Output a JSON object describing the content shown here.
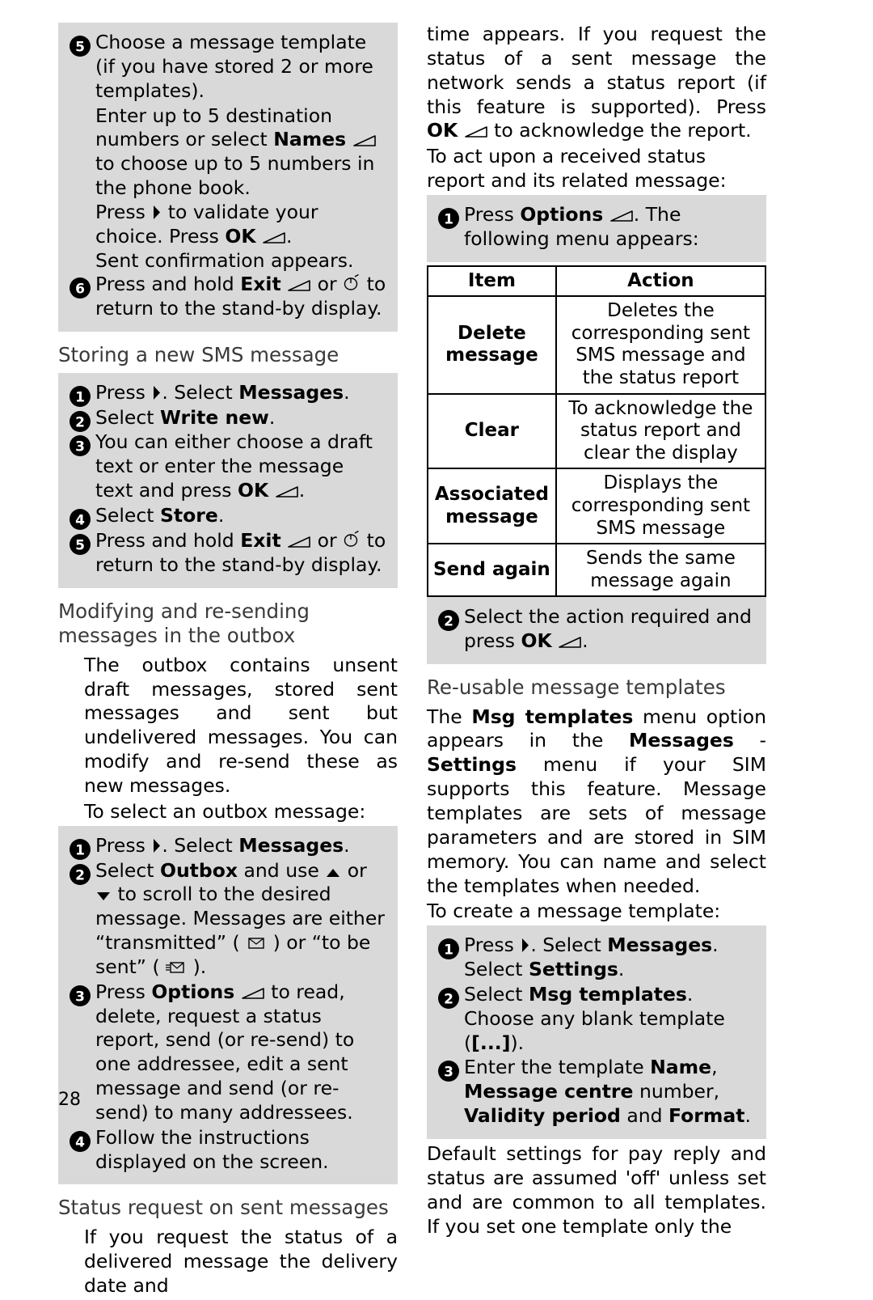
{
  "page_number": "28",
  "left_column": {
    "box1": {
      "steps": [
        {
          "num": 5,
          "lines": [
            "Choose a message template (if you have stored 2 or more templates).",
            "Enter up to 5 destination numbers or select __B:Names__ __ICON:softkey-left__ to choose up to 5 numbers in the phone book.",
            "Press __ICON:right-arrow__ to validate your choice. Press __B:OK__ __ICON:softkey-left__.",
            "Sent confirmation appears."
          ]
        },
        {
          "num": 6,
          "lines": [
            "Press and hold __B:Exit__ __ICON:softkey-right__ or __ICON:power-key__ to return to the stand-by display."
          ]
        }
      ]
    },
    "heading_storing": "Storing a new SMS message",
    "box2": {
      "steps": [
        {
          "num": 1,
          "lines": [
            "Press __ICON:right-arrow__. Select __B:Messages__."
          ]
        },
        {
          "num": 2,
          "lines": [
            "Select __B:Write new__."
          ]
        },
        {
          "num": 3,
          "lines": [
            "You can either choose a draft text or enter the message text and press __B:OK__ __ICON:softkey-left__."
          ]
        },
        {
          "num": 4,
          "lines": [
            "Select __B:Store__."
          ]
        },
        {
          "num": 5,
          "lines": [
            "Press and hold __B:Exit__ __ICON:softkey-right__ or __ICON:power-key__ to return to the stand-by display."
          ]
        }
      ]
    },
    "heading_modifying": "Modifying and re-sending messages in the outbox",
    "para_outbox": "The outbox contains unsent draft messages, stored sent messages and sent but undelivered messages. You can modify and re-send these as new messages.",
    "para_select_outbox": "To select an outbox message:",
    "box3": {
      "steps": [
        {
          "num": 1,
          "lines": [
            "Press __ICON:right-arrow__. Select __B:Messages__."
          ]
        },
        {
          "num": 2,
          "lines": [
            "Select __B:Outbox__ and use __ICON:up-arrow__ or __ICON:down-arrow__ to scroll to the desired message. Messages are either “transmitted” ( __ICON:envelope-sent__ ) or “to be sent” ( __ICON:envelope-pending__ )."
          ]
        },
        {
          "num": 3,
          "lines": [
            "Press __B:Options__ __ICON:softkey-left__ to read, delete, request a status report, send (or re-send) to one addressee, edit a sent message and send (or re-send) to many addressees."
          ]
        },
        {
          "num": 4,
          "lines": [
            "Follow the instructions displayed on the screen."
          ]
        }
      ]
    },
    "heading_status": "Status request on sent messages",
    "para_status": "If you request the status of a delivered message the delivery date and"
  },
  "right_column": {
    "para_top": "time appears. If you request the status of a sent message the network sends a status report (if this feature is supported). Press __B:OK__ __ICON:softkey-left__ to acknowledge the report.",
    "para_act": "To act upon a received status report and its related message:",
    "box1": {
      "steps": [
        {
          "num": 1,
          "lines": [
            "Press __B:Options__ __ICON:softkey-left__. The following menu appears:"
          ]
        }
      ]
    },
    "table": {
      "headers": [
        "Item",
        "Action"
      ],
      "rows": [
        {
          "item": "Delete message",
          "action": "Deletes the corresponding sent SMS message and the status report"
        },
        {
          "item": "Clear",
          "action": "To acknowledge the status report and clear the display"
        },
        {
          "item": "Associated message",
          "action": "Displays the corresponding sent SMS message"
        },
        {
          "item": "Send again",
          "action": "Sends the same message again"
        }
      ]
    },
    "box2": {
      "steps": [
        {
          "num": 2,
          "lines": [
            "Select the action required and press __B:OK__ __ICON:softkey-left__."
          ]
        }
      ]
    },
    "heading_templates": "Re-usable message templates",
    "para_templates": "The __B:Msg templates__ menu option appears in the __B:Messages__ - __B:Settings__ menu if your SIM supports this feature. Message templates are sets of message parameters and are stored in SIM memory. You can name and select the templates when needed.",
    "para_create": "To create a message template:",
    "box3": {
      "steps": [
        {
          "num": 1,
          "lines": [
            "Press __ICON:right-arrow__. Select __B:Messages__. Select __B:Settings__."
          ]
        },
        {
          "num": 2,
          "lines": [
            "Select __B:Msg templates__. Choose any blank template (__B:[...]__)."
          ]
        },
        {
          "num": 3,
          "lines": [
            "Enter the template __B:Name__, __B:Message centre__ number, __B:Validity period__ and __B:Format__."
          ]
        }
      ]
    },
    "para_default": "Default settings for pay reply and status are assumed 'off' unless set and are common to all templates. If you set one template only the"
  }
}
